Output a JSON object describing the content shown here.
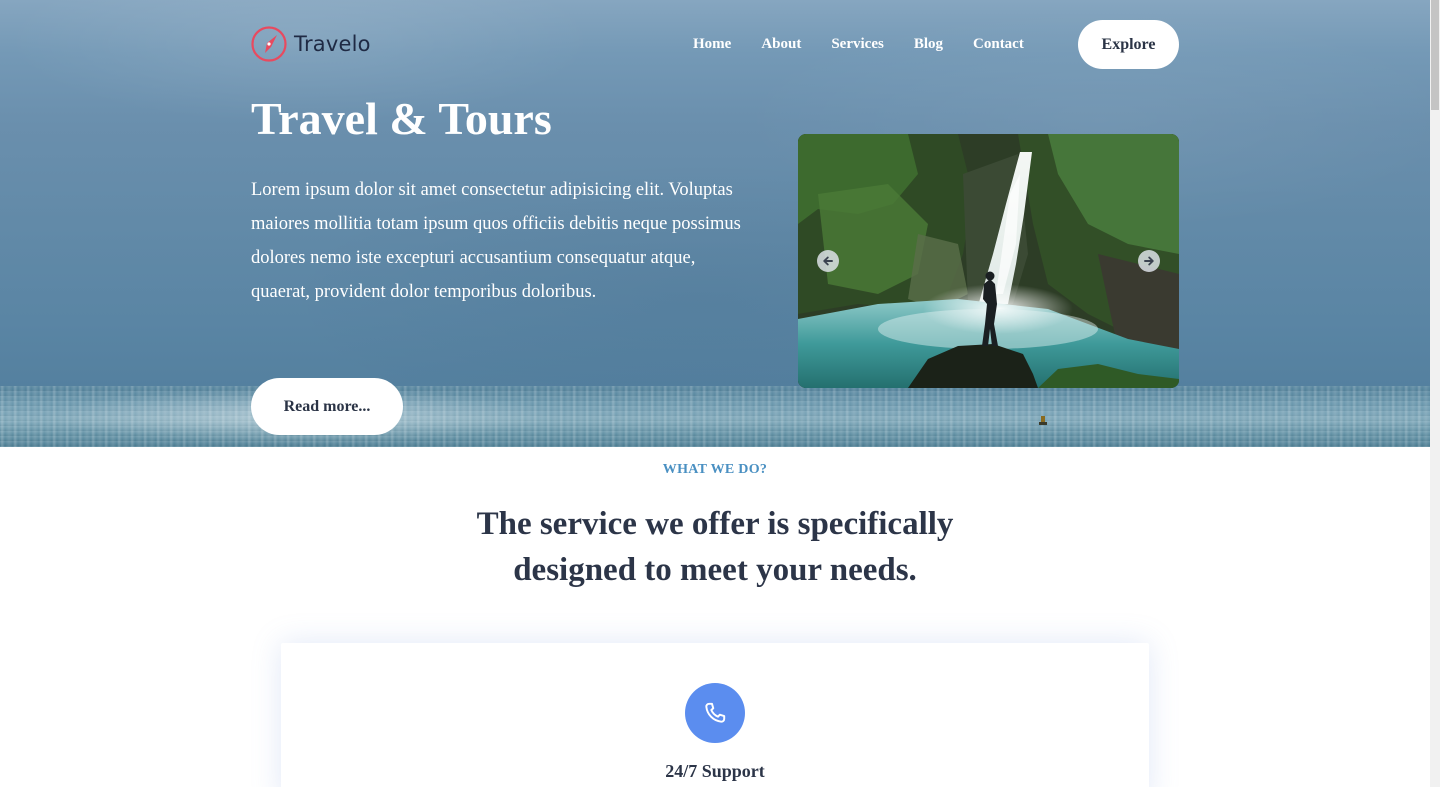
{
  "brand": {
    "name": "Travelo",
    "accent": "#e84a5f"
  },
  "nav": {
    "items": [
      {
        "label": "Home"
      },
      {
        "label": "About"
      },
      {
        "label": "Services"
      },
      {
        "label": "Blog"
      },
      {
        "label": "Contact"
      }
    ],
    "cta_label": "Explore"
  },
  "hero": {
    "title": "Travel & Tours",
    "text": "Lorem ipsum dolor sit amet consectetur adipisicing elit. Voluptas maiores mollitia totam ipsum quos officiis debitis neque possimus dolores nemo iste excepturi accusantium consequatur atque, quaerat, provident dolor temporibus doloribus.",
    "button_label": "Read more...",
    "slider": {
      "prev_icon": "arrow-left-circle-icon",
      "next_icon": "arrow-right-circle-icon"
    }
  },
  "services": {
    "eyebrow": "WHAT WE DO?",
    "title": "The service we offer is specifically designed to meet your needs.",
    "cards": [
      {
        "icon": "phone-icon",
        "title": "24/7 Support",
        "icon_color": "#5b8def"
      }
    ],
    "eyebrow_color": "#4a90c2"
  }
}
